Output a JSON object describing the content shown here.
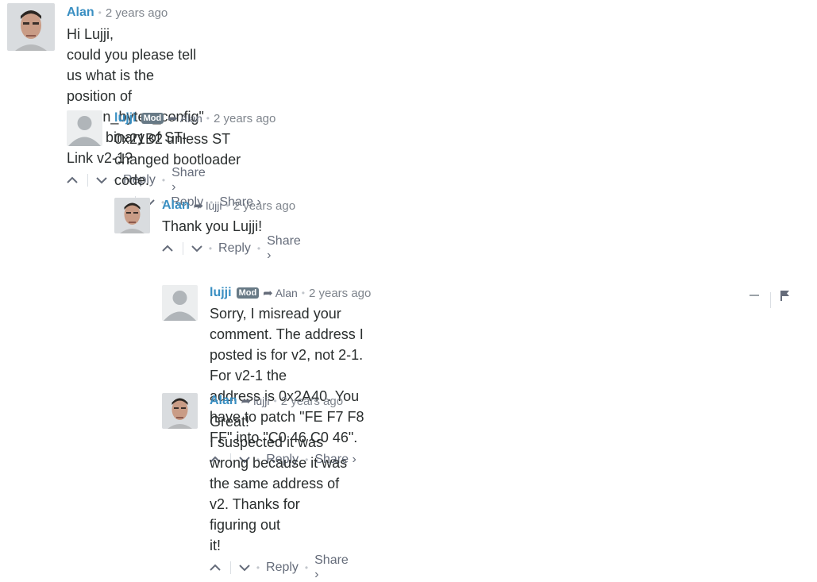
{
  "comments": [
    {
      "author": "Alan",
      "mod": "",
      "reply_to": "",
      "time": "2 years ago",
      "lines": [
        "Hi Lujji,",
        "could you please tell us what is the position of \"option_bytes_config\" in the binary of ST-Link v2-1?"
      ],
      "reply": "Reply",
      "share": "Share ›",
      "avatar": "photo"
    },
    {
      "author": "lujji",
      "mod": "Mod",
      "reply_to": "Alan",
      "time": "2 years ago",
      "lines": [
        "0x21B2 unless ST changed bootloader code."
      ],
      "reply": "Reply",
      "share": "Share ›",
      "avatar": "default"
    },
    {
      "author": "Alan",
      "mod": "",
      "reply_to": "lujji",
      "time": "2 years ago",
      "lines": [
        "Thank you Lujji!"
      ],
      "reply": "Reply",
      "share": "Share ›",
      "avatar": "photo"
    },
    {
      "author": "lujji",
      "mod": "Mod",
      "reply_to": "Alan",
      "time": "2 years ago",
      "lines": [
        "Sorry, I misread your comment. The address I posted is for v2, not 2-1. For v2-1 the",
        "address is 0x2A40. You have to patch \"FE F7 F8 FF\" into \"C0 46 C0 46\"."
      ],
      "reply": "Reply",
      "share": "Share ›",
      "avatar": "default"
    },
    {
      "author": "Alan",
      "mod": "",
      "reply_to": "lujji",
      "time": "2 years ago",
      "lines": [
        "Great!",
        "I suspected it was wrong because it was the same address of v2. Thanks for figuring out",
        "it!"
      ],
      "reply": "Reply",
      "share": "Share ›",
      "avatar": "photo"
    }
  ],
  "icons": {
    "upvote": "chevron-up-icon",
    "downvote": "chevron-down-icon",
    "reply_arrow": "reply-arrow-icon",
    "collapse": "minus-icon",
    "flag": "flag-icon"
  },
  "colors": {
    "author": "#3a8fc2",
    "meta": "#656c7a",
    "badge": "#687a86",
    "text": "#2a2e2e"
  }
}
